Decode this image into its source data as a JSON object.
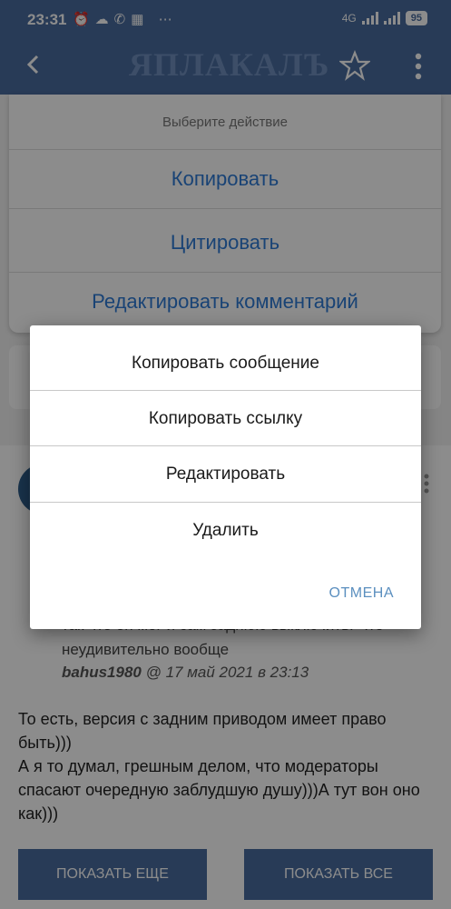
{
  "status_bar": {
    "time": "23:31",
    "network": "4G",
    "battery": "95"
  },
  "app_bar": {
    "logo": "ЯПЛАКАЛЪ"
  },
  "background_sheet": {
    "header": "Выберите действие",
    "options": [
      "Копировать",
      "Цитировать",
      "Редактировать комментарий"
    ]
  },
  "post": {
    "quote_line1": "так что он мог и сам заднюю выключить. Что",
    "quote_line2": "неудивительно вообще",
    "quote_author": "bahus1980",
    "quote_date": "@ 17 май 2021 в 23:13",
    "text": "То есть, версия с задним приводом имеет право быть)))\nА я то думал, грешным делом, что модераторы спасают очередную заблудшую душу)))А тут вон оно как)))",
    "show_more": "ПОКАЗАТЬ ЕЩЕ",
    "show_all": "ПОКАЗАТЬ ВСЕ"
  },
  "dialog": {
    "items": [
      "Копировать сообщение",
      "Копировать ссылку",
      "Редактировать",
      "Удалить"
    ],
    "cancel": "ОТМЕНА"
  },
  "colors": {
    "app_bar": "#4a6c9e",
    "accent": "#2e7bd6",
    "cancel": "#5b8fbf"
  }
}
